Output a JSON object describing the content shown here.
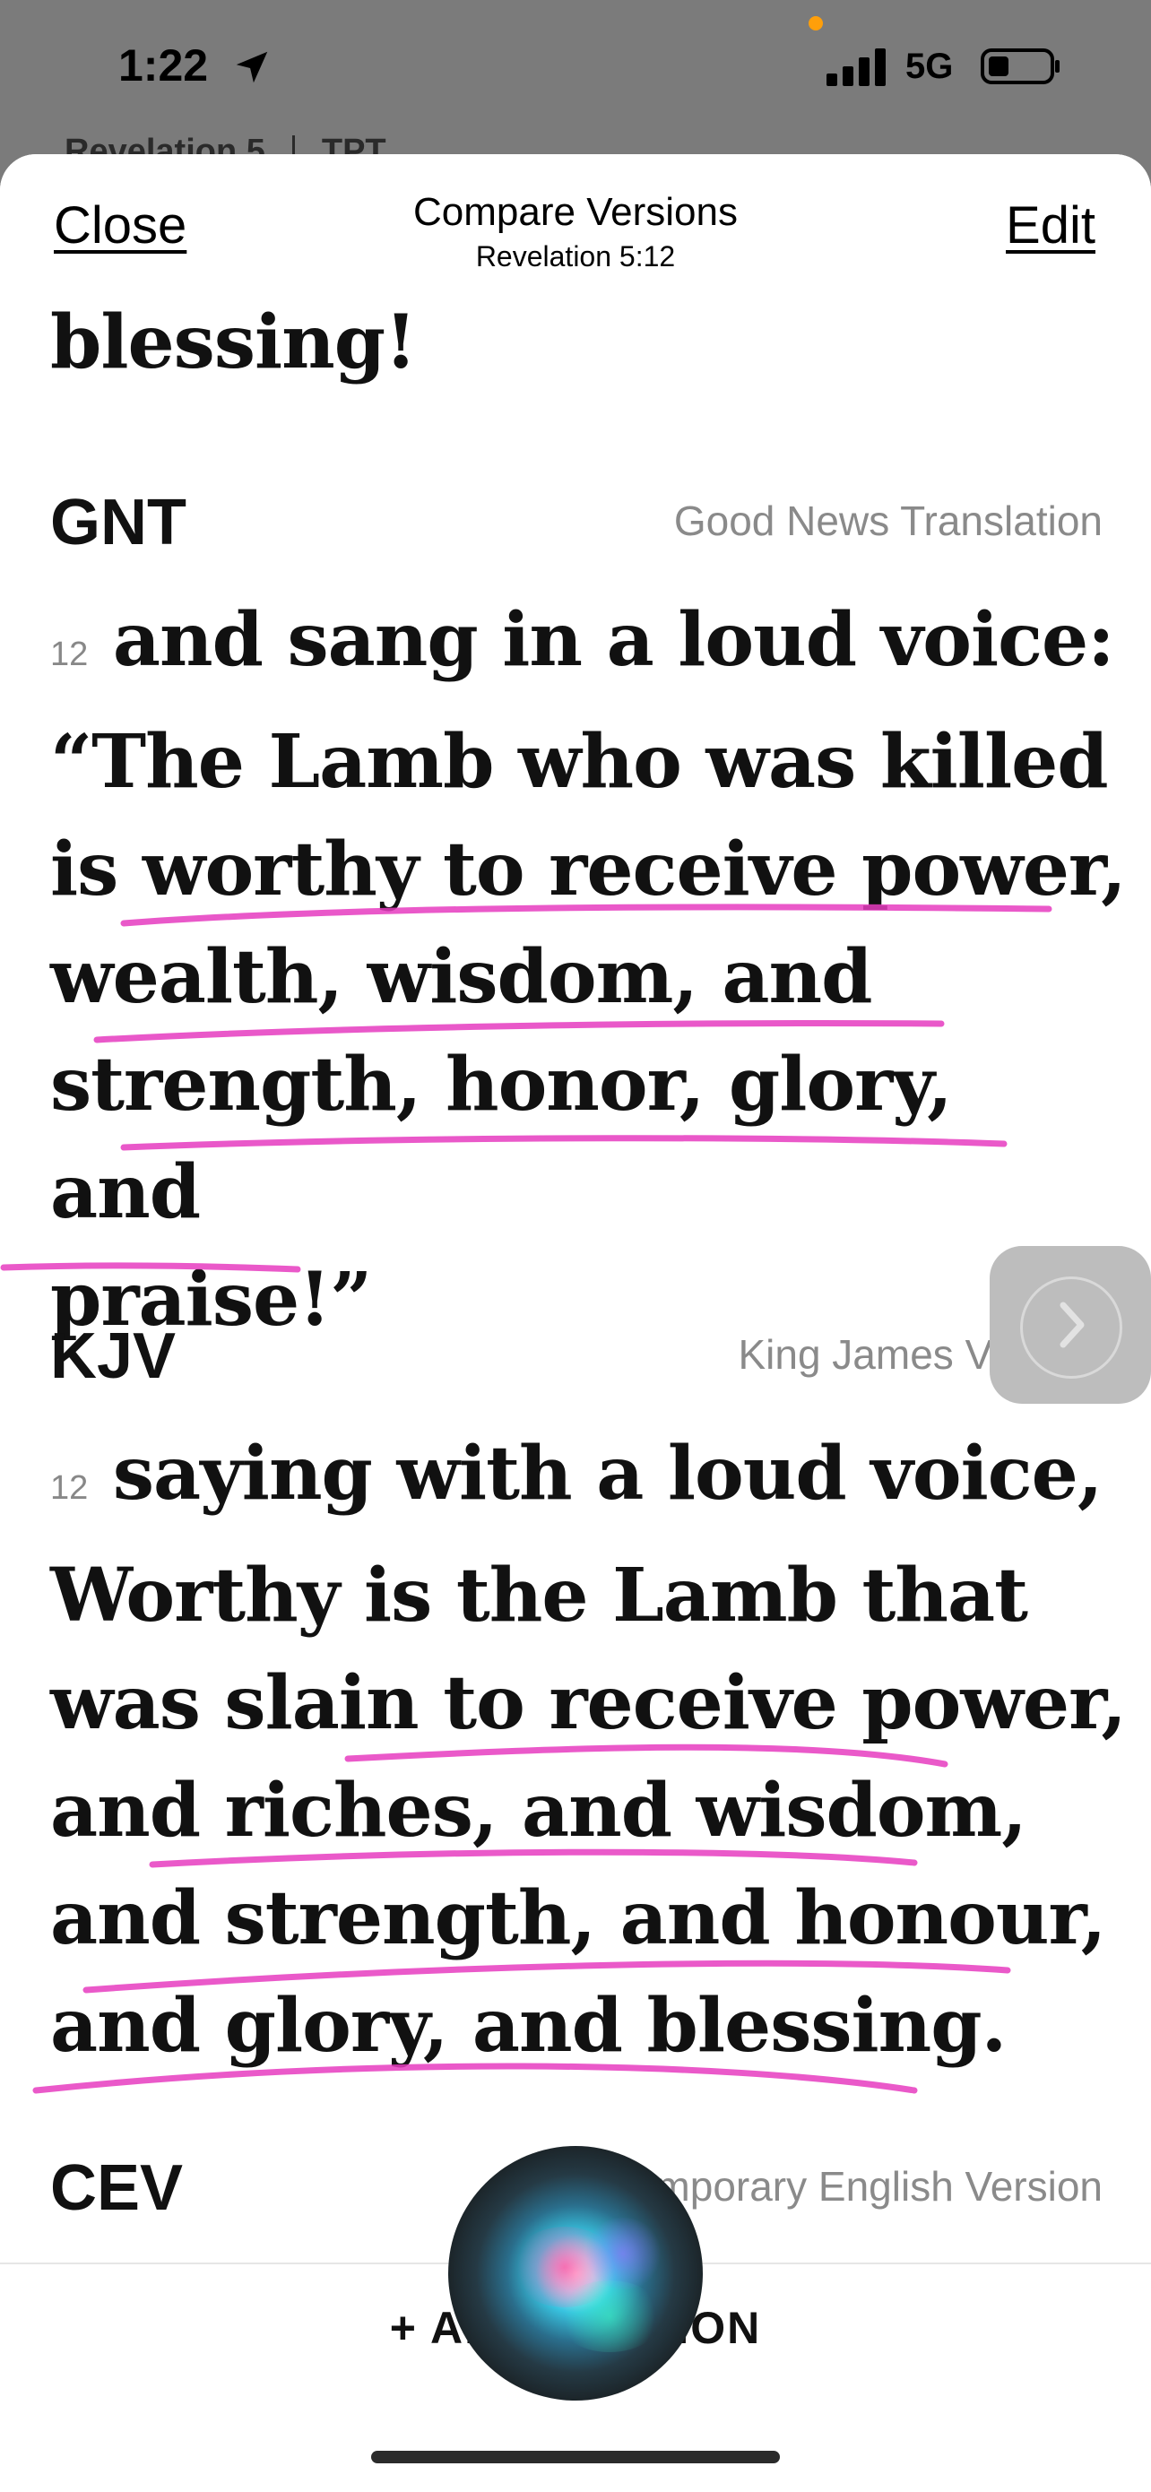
{
  "status_bar": {
    "time": "1:22",
    "network": "5G",
    "background_header": "Revelation 5",
    "background_header_version": "TPT"
  },
  "nav": {
    "close_label": "Close",
    "title": "Compare Versions",
    "subtitle": "Revelation 5:12",
    "edit_label": "Edit"
  },
  "partial_top": "blessing!",
  "versions": [
    {
      "abbr": "GNT",
      "name": "Good News Translation",
      "verse_number": "12",
      "lines": [
        "and sang in a loud voice:",
        "“The Lamb who was killed",
        "is worthy to receive power,",
        "wealth, wisdom, and",
        "strength, honor, glory, and",
        "praise!”"
      ]
    },
    {
      "abbr": "KJV",
      "name": "King James Version",
      "verse_number": "12",
      "lines": [
        "saying with a loud voice,",
        "Worthy is the Lamb that",
        "was slain to receive power,",
        "and riches, and wisdom,",
        "and strength, and honour,",
        "and glory, and blessing."
      ]
    },
    {
      "abbr": "CEV",
      "name": "Contemporary English Version",
      "verse_number": "",
      "lines": []
    }
  ],
  "bottom": {
    "add_version_label": "+ ADD VERSION"
  },
  "colors": {
    "highlight_ink": "#e63cc0",
    "accent_text": "#111111",
    "muted_text": "#8a8a8a"
  },
  "icons": {
    "location": "location-arrow-icon",
    "signal": "cellular-signal-icon",
    "battery": "battery-icon",
    "pager": "chevron-right-icon",
    "siri": "siri-orb-icon"
  }
}
